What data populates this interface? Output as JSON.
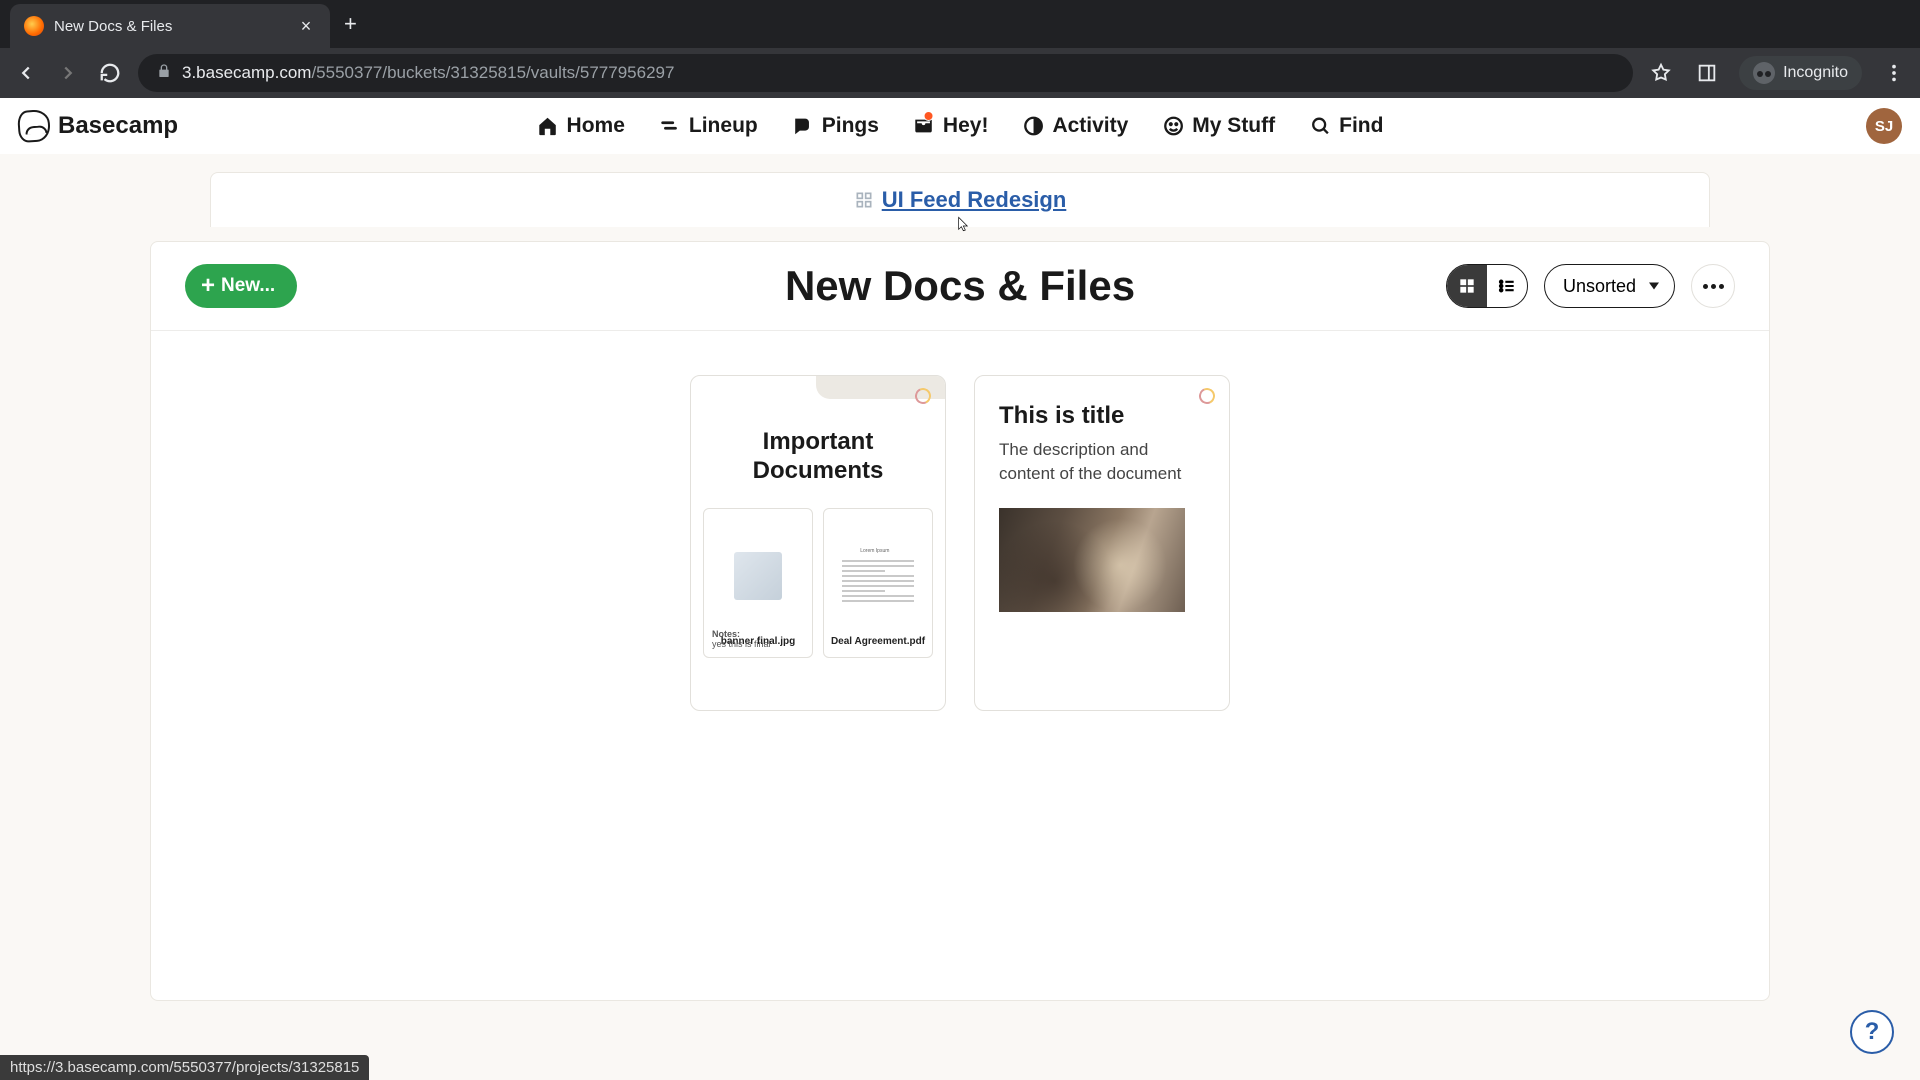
{
  "browser": {
    "tab_title": "New Docs & Files",
    "url_host": "3.basecamp.com",
    "url_path": "/5550377/buckets/31325815/vaults/5777956297",
    "incognito_label": "Incognito",
    "status_hover": "https://3.basecamp.com/5550377/projects/31325815"
  },
  "app": {
    "logo_text": "Basecamp",
    "nav": {
      "home": "Home",
      "lineup": "Lineup",
      "pings": "Pings",
      "hey": "Hey!",
      "activity": "Activity",
      "mystuff": "My Stuff",
      "find": "Find"
    },
    "avatar_initials": "SJ",
    "breadcrumb": "UI Feed Redesign",
    "page_title": "New Docs & Files",
    "new_button": "New...",
    "sort_value": "Unsorted",
    "help_label": "?"
  },
  "cards": {
    "folder": {
      "title": "Important Documents",
      "files": [
        {
          "name": "banner final.jpg",
          "notes_label": "Notes:",
          "notes_text": "yes this is final"
        },
        {
          "name": "Deal Agreement.pdf",
          "preview_heading": "Lorem Ipsum"
        }
      ]
    },
    "doc": {
      "title": "This is title",
      "description": "The description and content of the document"
    }
  }
}
